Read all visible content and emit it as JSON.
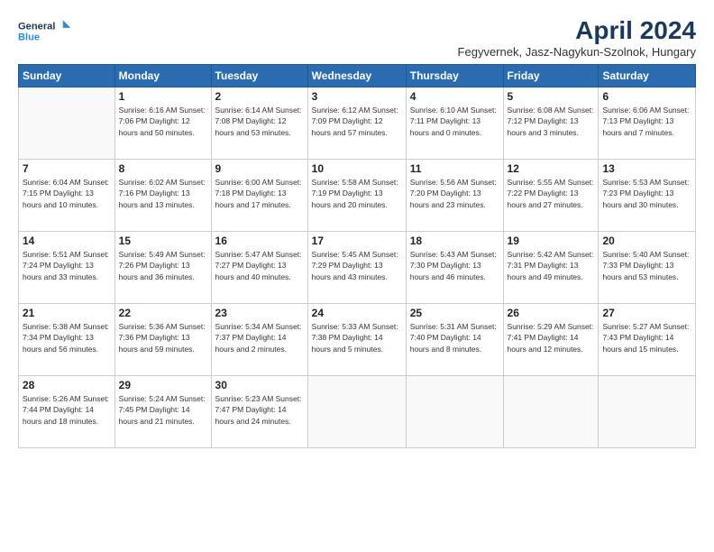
{
  "header": {
    "logo_line1": "General",
    "logo_line2": "Blue",
    "title": "April 2024",
    "subtitle": "Fegyvernek, Jasz-Nagykun-Szolnok, Hungary"
  },
  "columns": [
    "Sunday",
    "Monday",
    "Tuesday",
    "Wednesday",
    "Thursday",
    "Friday",
    "Saturday"
  ],
  "weeks": [
    [
      {
        "day": "",
        "info": ""
      },
      {
        "day": "1",
        "info": "Sunrise: 6:16 AM\nSunset: 7:06 PM\nDaylight: 12 hours\nand 50 minutes."
      },
      {
        "day": "2",
        "info": "Sunrise: 6:14 AM\nSunset: 7:08 PM\nDaylight: 12 hours\nand 53 minutes."
      },
      {
        "day": "3",
        "info": "Sunrise: 6:12 AM\nSunset: 7:09 PM\nDaylight: 12 hours\nand 57 minutes."
      },
      {
        "day": "4",
        "info": "Sunrise: 6:10 AM\nSunset: 7:11 PM\nDaylight: 13 hours\nand 0 minutes."
      },
      {
        "day": "5",
        "info": "Sunrise: 6:08 AM\nSunset: 7:12 PM\nDaylight: 13 hours\nand 3 minutes."
      },
      {
        "day": "6",
        "info": "Sunrise: 6:06 AM\nSunset: 7:13 PM\nDaylight: 13 hours\nand 7 minutes."
      }
    ],
    [
      {
        "day": "7",
        "info": "Sunrise: 6:04 AM\nSunset: 7:15 PM\nDaylight: 13 hours\nand 10 minutes."
      },
      {
        "day": "8",
        "info": "Sunrise: 6:02 AM\nSunset: 7:16 PM\nDaylight: 13 hours\nand 13 minutes."
      },
      {
        "day": "9",
        "info": "Sunrise: 6:00 AM\nSunset: 7:18 PM\nDaylight: 13 hours\nand 17 minutes."
      },
      {
        "day": "10",
        "info": "Sunrise: 5:58 AM\nSunset: 7:19 PM\nDaylight: 13 hours\nand 20 minutes."
      },
      {
        "day": "11",
        "info": "Sunrise: 5:56 AM\nSunset: 7:20 PM\nDaylight: 13 hours\nand 23 minutes."
      },
      {
        "day": "12",
        "info": "Sunrise: 5:55 AM\nSunset: 7:22 PM\nDaylight: 13 hours\nand 27 minutes."
      },
      {
        "day": "13",
        "info": "Sunrise: 5:53 AM\nSunset: 7:23 PM\nDaylight: 13 hours\nand 30 minutes."
      }
    ],
    [
      {
        "day": "14",
        "info": "Sunrise: 5:51 AM\nSunset: 7:24 PM\nDaylight: 13 hours\nand 33 minutes."
      },
      {
        "day": "15",
        "info": "Sunrise: 5:49 AM\nSunset: 7:26 PM\nDaylight: 13 hours\nand 36 minutes."
      },
      {
        "day": "16",
        "info": "Sunrise: 5:47 AM\nSunset: 7:27 PM\nDaylight: 13 hours\nand 40 minutes."
      },
      {
        "day": "17",
        "info": "Sunrise: 5:45 AM\nSunset: 7:29 PM\nDaylight: 13 hours\nand 43 minutes."
      },
      {
        "day": "18",
        "info": "Sunrise: 5:43 AM\nSunset: 7:30 PM\nDaylight: 13 hours\nand 46 minutes."
      },
      {
        "day": "19",
        "info": "Sunrise: 5:42 AM\nSunset: 7:31 PM\nDaylight: 13 hours\nand 49 minutes."
      },
      {
        "day": "20",
        "info": "Sunrise: 5:40 AM\nSunset: 7:33 PM\nDaylight: 13 hours\nand 53 minutes."
      }
    ],
    [
      {
        "day": "21",
        "info": "Sunrise: 5:38 AM\nSunset: 7:34 PM\nDaylight: 13 hours\nand 56 minutes."
      },
      {
        "day": "22",
        "info": "Sunrise: 5:36 AM\nSunset: 7:36 PM\nDaylight: 13 hours\nand 59 minutes."
      },
      {
        "day": "23",
        "info": "Sunrise: 5:34 AM\nSunset: 7:37 PM\nDaylight: 14 hours\nand 2 minutes."
      },
      {
        "day": "24",
        "info": "Sunrise: 5:33 AM\nSunset: 7:38 PM\nDaylight: 14 hours\nand 5 minutes."
      },
      {
        "day": "25",
        "info": "Sunrise: 5:31 AM\nSunset: 7:40 PM\nDaylight: 14 hours\nand 8 minutes."
      },
      {
        "day": "26",
        "info": "Sunrise: 5:29 AM\nSunset: 7:41 PM\nDaylight: 14 hours\nand 12 minutes."
      },
      {
        "day": "27",
        "info": "Sunrise: 5:27 AM\nSunset: 7:43 PM\nDaylight: 14 hours\nand 15 minutes."
      }
    ],
    [
      {
        "day": "28",
        "info": "Sunrise: 5:26 AM\nSunset: 7:44 PM\nDaylight: 14 hours\nand 18 minutes."
      },
      {
        "day": "29",
        "info": "Sunrise: 5:24 AM\nSunset: 7:45 PM\nDaylight: 14 hours\nand 21 minutes."
      },
      {
        "day": "30",
        "info": "Sunrise: 5:23 AM\nSunset: 7:47 PM\nDaylight: 14 hours\nand 24 minutes."
      },
      {
        "day": "",
        "info": ""
      },
      {
        "day": "",
        "info": ""
      },
      {
        "day": "",
        "info": ""
      },
      {
        "day": "",
        "info": ""
      }
    ]
  ]
}
